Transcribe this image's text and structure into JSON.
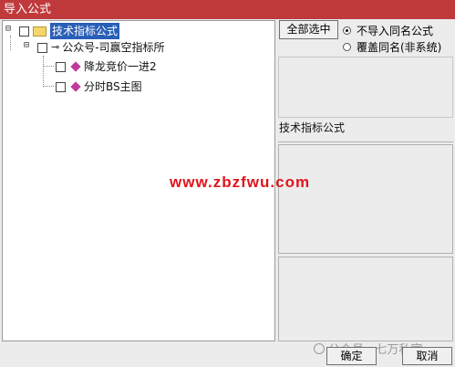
{
  "window": {
    "title": "导入公式"
  },
  "tree": {
    "root": {
      "expander": "⊟",
      "label": "技术指标公式"
    },
    "group": {
      "expander": "⊟",
      "key": "⊸",
      "label": "公众号-司赢空指标所"
    },
    "items": [
      {
        "label": "降龙竞价一进2"
      },
      {
        "label": "分时BS主图"
      }
    ]
  },
  "options": {
    "select_all_label": "全部选中",
    "radio_no_import": "不导入同名公式",
    "radio_overwrite": "覆盖同名(非系统)"
  },
  "info": {
    "label": "技术指标公式"
  },
  "buttons": {
    "ok": "确定",
    "cancel": "取消"
  },
  "watermark": {
    "site": "www.zbzfwu.com",
    "account": "公众号 · 七万私家"
  },
  "colors": {
    "title_bar": "#C0393B",
    "selection": "#2A5FB8",
    "watermark": "#E0141C"
  }
}
